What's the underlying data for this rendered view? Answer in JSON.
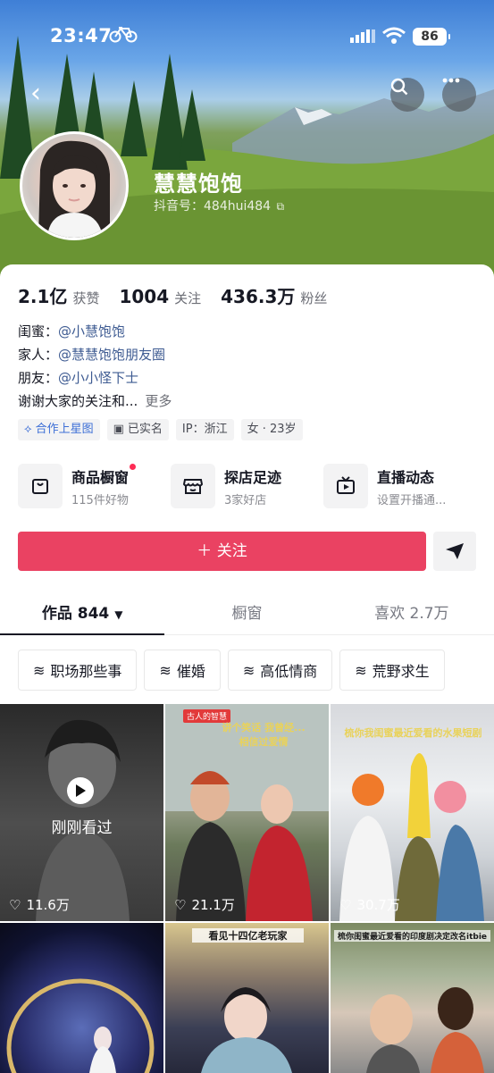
{
  "status_bar": {
    "time": "23:47",
    "battery": "86"
  },
  "profile": {
    "nickname": "慧慧饱饱",
    "douyin_id": "抖音号：484hui484"
  },
  "stats": [
    {
      "value": "2.1亿",
      "label": "获赞"
    },
    {
      "value": "1004",
      "label": "关注"
    },
    {
      "value": "436.3万",
      "label": "粉丝"
    }
  ],
  "bio": {
    "lines": [
      {
        "prefix": "闺蜜：",
        "mention": "@小慧饱饱"
      },
      {
        "prefix": "家人：",
        "mention": "@慧慧饱饱朋友圈"
      },
      {
        "prefix": "朋友：",
        "mention": "@小小怪下士"
      }
    ],
    "text": "谢谢大家的关注和...",
    "more": "更多"
  },
  "tags": [
    "合作上星图",
    "已实名",
    "IP：浙江",
    "女 · 23岁"
  ],
  "features": [
    {
      "title": "商品橱窗",
      "sub": "115件好物"
    },
    {
      "title": "探店足迹",
      "sub": "3家好店"
    },
    {
      "title": "直播动态",
      "sub": "设置开播通..."
    }
  ],
  "follow_label": "＋ 关注",
  "tabs": [
    {
      "label": "作品 844"
    },
    {
      "label": "橱窗"
    },
    {
      "label": "喜欢 2.7万"
    }
  ],
  "chips": [
    "职场那些事",
    "催婚",
    "高低情商",
    "荒野求生"
  ],
  "videos": [
    {
      "likes": "11.6万",
      "overlay": "刚刚看过"
    },
    {
      "likes": "21.1万",
      "caption": "讲个笑话 我曾经... 相信过爱情",
      "badge": "古人的智慧"
    },
    {
      "likes": "30.7万",
      "caption": "梳你我闺蜜最近爱看的水果短剧"
    },
    {
      "likes": ""
    },
    {
      "likes": "",
      "caption": "看见十四亿老玩家"
    },
    {
      "likes": "",
      "caption": "梳你闺蜜最近爱看的印度剧决定改名itbie"
    }
  ],
  "colors": {
    "follow": "#ea4262",
    "mention": "#3e5b92",
    "dot": "#fe2c55"
  }
}
